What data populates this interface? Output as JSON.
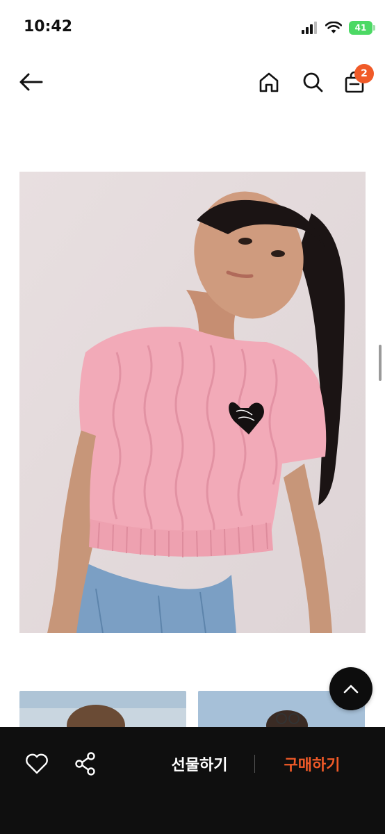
{
  "status_bar": {
    "time": "10:42",
    "battery": "41"
  },
  "header": {
    "cart_count": "2"
  },
  "bottom_bar": {
    "gift_label": "선물하기",
    "buy_label": "구매하기"
  },
  "icons": {
    "back": "arrow-left-icon",
    "home": "home-icon",
    "search": "search-icon",
    "cart": "shopping-bag-icon",
    "like": "heart-icon",
    "share": "share-icon",
    "scroll_top": "chevron-up-icon",
    "signal": "cellular-signal-icon",
    "wifi": "wifi-icon",
    "battery": "battery-icon"
  },
  "colors": {
    "accent": "#f05a28",
    "badge": "#f05a28",
    "bottom_bar": "#0f0f0f",
    "battery": "#4cd964"
  }
}
